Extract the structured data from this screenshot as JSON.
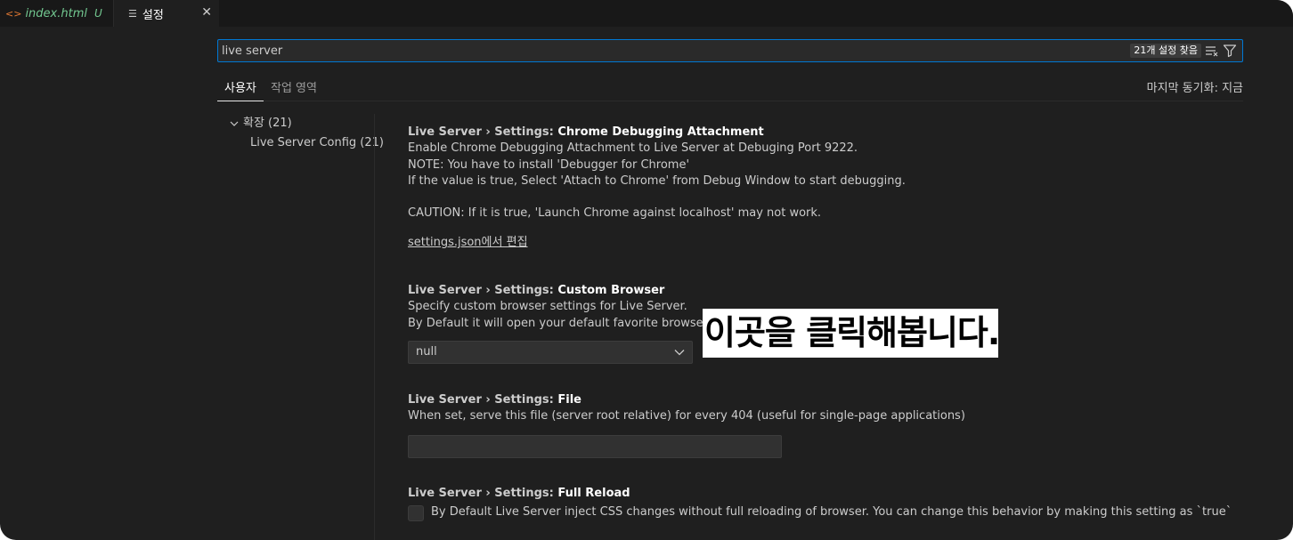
{
  "tabs": [
    {
      "label": "index.html",
      "badge": "U"
    },
    {
      "label": "설정",
      "close": "✕"
    }
  ],
  "search": {
    "value": "live server",
    "result_count": "21개 설정 찾음"
  },
  "scope_tabs": {
    "user": "사용자",
    "workspace": "작업 영역",
    "sync_status": "마지막 동기화: 지금"
  },
  "toc": {
    "group": "확장 (21)",
    "item": "Live Server Config (21)"
  },
  "settings": [
    {
      "category": "Live Server › Settings: ",
      "name": "Chrome Debugging Attachment",
      "desc": [
        "Enable Chrome Debugging Attachment to Live Server at Debuging Port 9222.",
        "NOTE: You have to install 'Debugger for Chrome'",
        "If the value is true, Select 'Attach to Chrome' from Debug Window to start debugging.",
        "CAUTION: If it is true, 'Launch Chrome against localhost' may not work."
      ],
      "link": "settings.json에서 편집"
    },
    {
      "category": "Live Server › Settings: ",
      "name": "Custom Browser",
      "desc": [
        "Specify custom browser settings for Live Server.",
        "By Default it will open your default favorite browser."
      ],
      "value": "null"
    },
    {
      "category": "Live Server › Settings: ",
      "name": "File",
      "desc": [
        "When set, serve this file (server root relative) for every 404 (useful for single-page applications)"
      ],
      "value": ""
    },
    {
      "category": "Live Server › Settings: ",
      "name": "Full Reload",
      "desc": [
        "By Default Live Server inject CSS changes without full reloading of browser. You can change this behavior by making this setting as `true`"
      ]
    }
  ],
  "annotation": "이곳을 클릭해봅니다.",
  "colors": {
    "accent": "#0078d4",
    "modified": "#73c991",
    "html_icon": "#e37933",
    "background": "#1f1f1f"
  },
  "icons": [
    "html-file-icon",
    "settings-file-icon",
    "close-icon",
    "clear-filter-icon",
    "filter-icon",
    "chevron-down-icon"
  ]
}
